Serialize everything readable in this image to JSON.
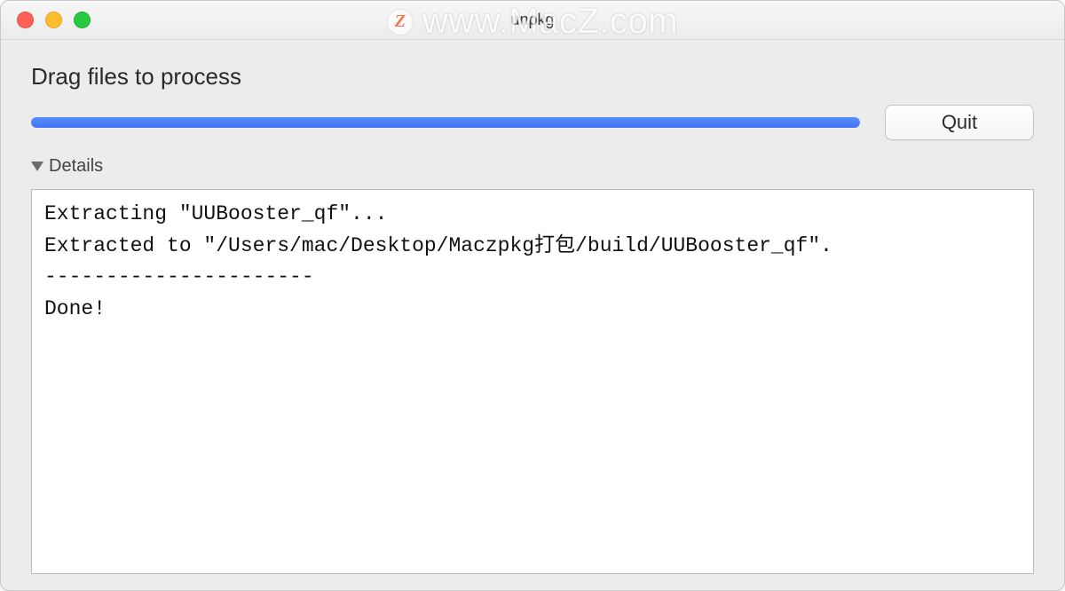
{
  "window": {
    "title": "unpkg"
  },
  "main": {
    "prompt": "Drag files to process",
    "progress_percent": 100,
    "quit_label": "Quit",
    "details_label": "Details",
    "log_text": "Extracting \"UUBooster_qf\"...\nExtracted to \"/Users/mac/Desktop/Maczpkg打包/build/UUBooster_qf\".\n----------------------\nDone!"
  },
  "watermark": {
    "badge": "Z",
    "text": "www.MacZ.com"
  }
}
